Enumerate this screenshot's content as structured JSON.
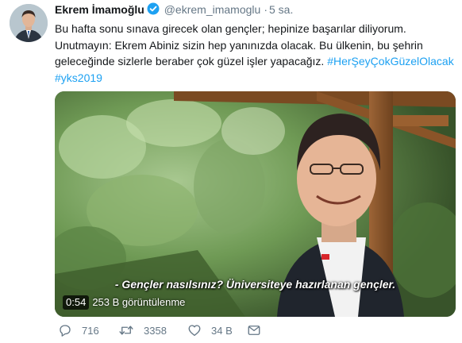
{
  "author": {
    "name": "Ekrem İmamoğlu",
    "handle": "@ekrem_imamoglu",
    "time": "5 sa.",
    "verified_color": "#1da1f2"
  },
  "tweet": {
    "line1": "Bu hafta sonu sınava girecek olan gençler; hepinize başarılar diliyorum.",
    "line2": "Unutmayın: Ekrem Abiniz sizin hep yanınızda olacak. Bu ülkenin, bu şehrin",
    "line3_text": "geleceğinde sizlerle beraber çok güzel işler yapacağız.",
    "hashtag1": "#HerŞeyÇokGüzelOlacak",
    "hashtag2": "#yks2019"
  },
  "video": {
    "caption": "- Gençler nasılsınız? Üniversiteye hazırlanan gençler.",
    "duration": "0:54",
    "views": "253 B görüntülenme"
  },
  "actions": {
    "reply_icon": "reply-icon",
    "reply_count": "716",
    "retweet_icon": "retweet-icon",
    "retweet_count": "3358",
    "like_icon": "heart-icon",
    "like_count": "34 B",
    "message_icon": "message-icon"
  },
  "colors": {
    "link": "#1da1f2",
    "secondary_text": "#657786"
  }
}
